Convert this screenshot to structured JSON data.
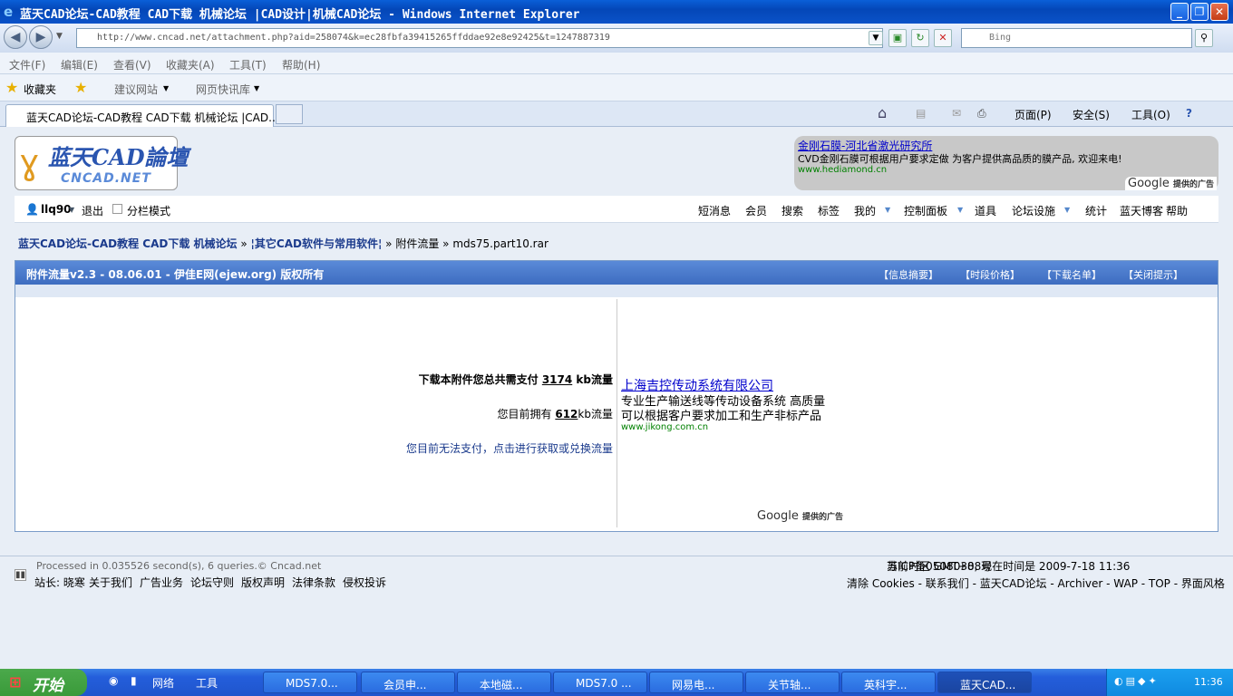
{
  "window": {
    "title": "蓝天CAD论坛-CAD教程 CAD下载 机械论坛 |CAD设计|机械CAD论坛 - Windows Internet Explorer",
    "address": "http://www.cncad.net/attachment.php?aid=258074&k=ec28fbfa39415265ffddae92e8e92425&t=1247887319",
    "search_placeholder": "Bing"
  },
  "menu": [
    "文件(F)",
    "编辑(E)",
    "查看(V)",
    "收藏夹(A)",
    "工具(T)",
    "帮助(H)"
  ],
  "favorites": {
    "fav": "收藏夹",
    "suggest": "建议网站",
    "slices": "网页快讯库"
  },
  "tab": {
    "label": "蓝天CAD论坛-CAD教程 CAD下载 机械论坛 |CAD...",
    "page": "页面(P)",
    "safety": "安全(S)",
    "tools": "工具(O)"
  },
  "ad_top": {
    "link": "金刚石膜-河北省激光研究所",
    "desc": "CVD金刚石膜可根据用户要求定做 为客户提供高品质的膜产品, 欢迎来电!",
    "url": "www.hediamond.cn",
    "google": "Google",
    "google_sub": "提供的广告"
  },
  "logo": {
    "title": "蓝天CAD論壇",
    "sub": "CNCAD.NET"
  },
  "user": {
    "name": "llq90",
    "logout": "退出",
    "split": "分栏模式",
    "nav": [
      "短消息",
      "会员",
      "搜索",
      "标签",
      "我的",
      "控制面板",
      "道具",
      "论坛设施",
      "统计",
      "蓝天博客",
      "帮助"
    ]
  },
  "crumb": {
    "forum": "蓝天CAD论坛-CAD教程 CAD下载 机械论坛",
    "sub": "其它CAD软件与常用软件",
    "page": "附件流量",
    "file": "mds75.part10.rar"
  },
  "panel": {
    "title": "附件流量v2.3 - 08.06.01 - 伊佳E网(ejew.org) 版权所有",
    "links": [
      "【信息摘要】",
      "【时段价格】",
      "【下载名单】",
      "【关闭提示】"
    ],
    "need_pre": "下载本附件您总共需支付",
    "need_val": "3174",
    "need_post": "kb流量",
    "have_pre": "您目前拥有",
    "have_val": "612",
    "have_post": "kb流量",
    "cannot": "您目前无法支付，点击进行获取或兑换流量"
  },
  "ad_mid": {
    "link": "上海吉控传动系统有限公司",
    "l1": "专业生产输送线等传动设备系统 高质量",
    "l2": "可以根据客户要求加工和生产非标产品",
    "url": "www.jikong.com.cn",
    "google": "Google",
    "google_sub": "提供的广告"
  },
  "footer": {
    "processed": "Processed in 0.035526 second(s), 6 queries.© Cncad.net",
    "admin": "站长: 晓寒",
    "links": [
      "关于我们",
      "广告业务",
      "论坛守则",
      "版权声明",
      "法律条款",
      "侵权投诉"
    ],
    "time": "当前时区 GMT+8, 现在时间是 2009-7-18 11:36",
    "icp": "苏ICP备05080308号",
    "right": "清除 Cookies - 联系我们 - 蓝天CAD论坛 - Archiver - WAP - TOP - 界面风格"
  },
  "taskbar": {
    "start": "开始",
    "net": "网络",
    "tools": "工具",
    "tasks": [
      "MDS7.0...",
      "会员申...",
      "本地磁...",
      "MDS7.0 ...",
      "网易电...",
      "关节轴...",
      "英科宇...",
      "蓝天CAD..."
    ],
    "clock": "11:36"
  }
}
